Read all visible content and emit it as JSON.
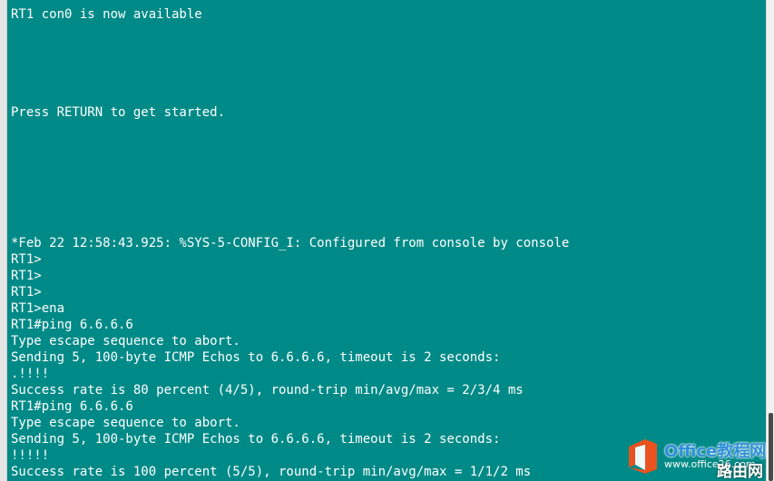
{
  "terminal": {
    "background_color": "#008a87",
    "text_color": "#ffffff",
    "lines": [
      "RT1 con0 is now available",
      "",
      "",
      "",
      "",
      "",
      "Press RETURN to get started.",
      "",
      "",
      "",
      "",
      "",
      "",
      "",
      "*Feb 22 12:58:43.925: %SYS-5-CONFIG_I: Configured from console by console",
      "RT1>",
      "RT1>",
      "RT1>",
      "RT1>ena",
      "RT1#ping 6.6.6.6",
      "Type escape sequence to abort.",
      "Sending 5, 100-byte ICMP Echos to 6.6.6.6, timeout is 2 seconds:",
      ".!!!!",
      "Success rate is 80 percent (4/5), round-trip min/avg/max = 2/3/4 ms",
      "RT1#ping 6.6.6.6",
      "Type escape sequence to abort.",
      "Sending 5, 100-byte ICMP Echos to 6.6.6.6, timeout is 2 seconds:",
      "!!!!!",
      "Success rate is 100 percent (5/5), round-trip min/avg/max = 1/1/2 ms"
    ]
  },
  "watermark": {
    "logo_icon": "office-logo-icon",
    "brand": "Office教程网",
    "url": "www.office26.com",
    "corner_text": "路由网",
    "brand_color": "#2f8fd8",
    "logo_color": "#e8531f"
  }
}
